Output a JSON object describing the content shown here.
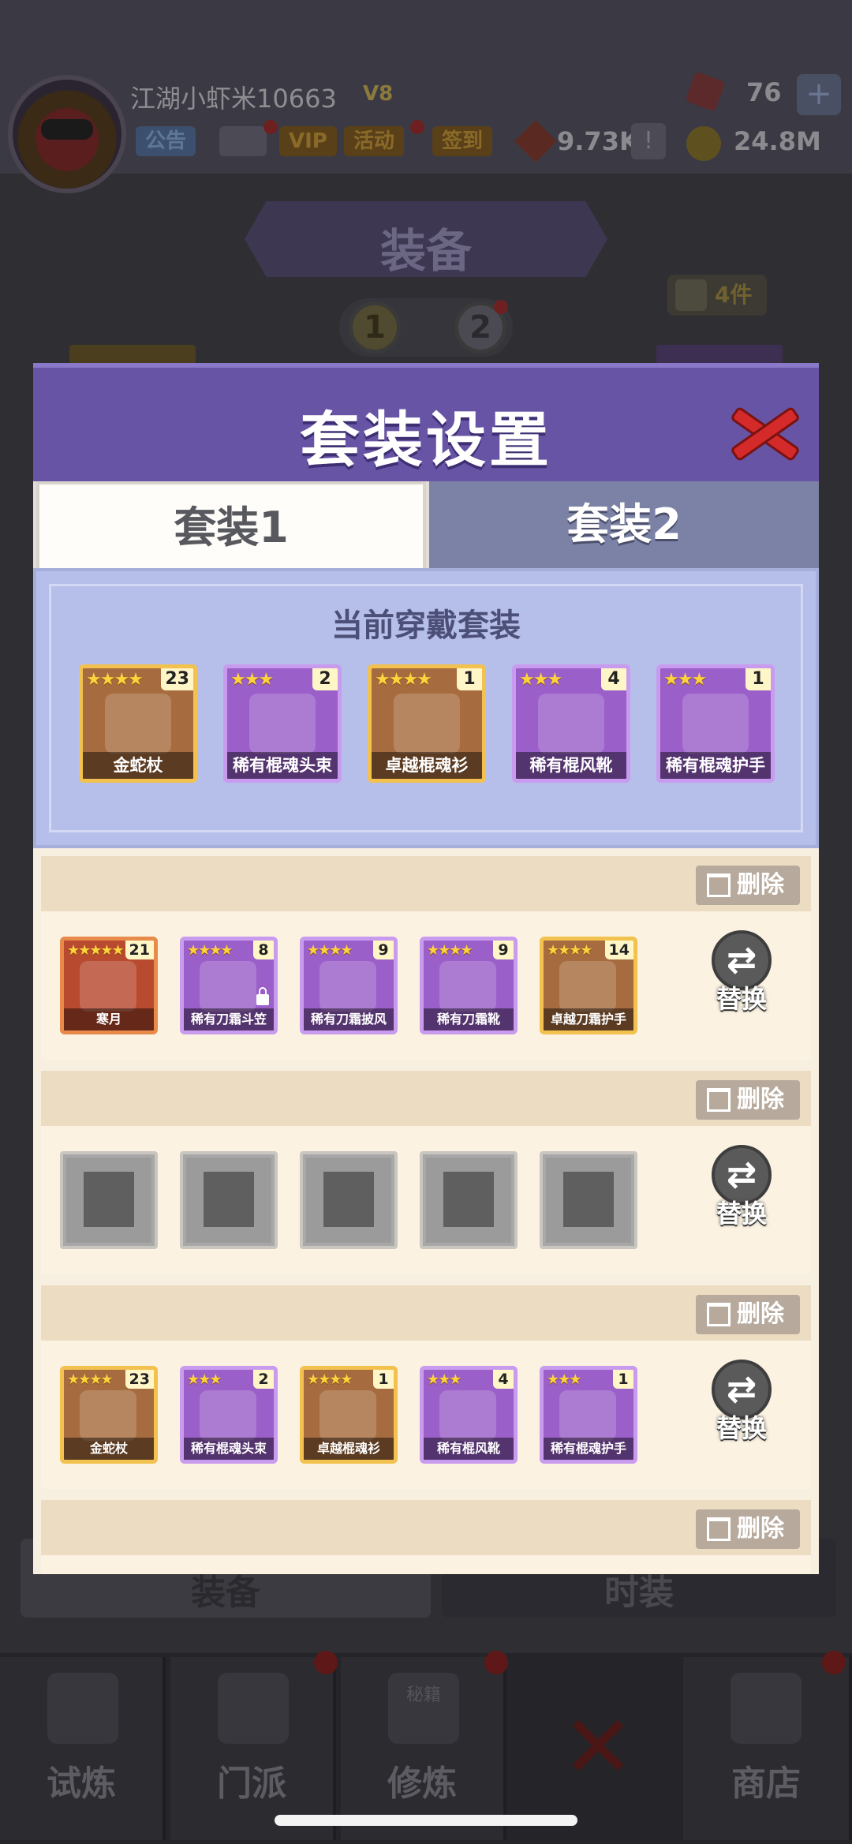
{
  "header": {
    "username": "江湖小虾米10663",
    "vip_level": "V8",
    "buttons": {
      "notice": "公告",
      "vip": "VIP",
      "activity": "活动",
      "signin": "签到"
    },
    "resources": {
      "gems": "76",
      "tickets": "9.73K",
      "gold": "24.8M"
    },
    "plus": "+",
    "info": "!"
  },
  "page": {
    "title": "装备",
    "count_badge": "4件",
    "pages": [
      "1",
      "2"
    ],
    "bottom_tabs": [
      "装备",
      "时装"
    ]
  },
  "nav": {
    "items": [
      "试炼",
      "门派",
      "修炼",
      "",
      "商店"
    ],
    "book_text": "秘籍"
  },
  "modal": {
    "title": "套装设置",
    "tabs": [
      "套装1",
      "套装2"
    ],
    "current_title": "当前穿戴套装",
    "current_items": [
      {
        "name": "金蛇杖",
        "stars": "★★★★",
        "count": "23",
        "rarity": "gold"
      },
      {
        "name": "稀有棍魂头束",
        "stars": "★★★",
        "count": "2",
        "rarity": "purple"
      },
      {
        "name": "卓越棍魂衫",
        "stars": "★★★★",
        "count": "1",
        "rarity": "gold"
      },
      {
        "name": "稀有棍风靴",
        "stars": "★★★",
        "count": "4",
        "rarity": "purple"
      },
      {
        "name": "稀有棍魂护手",
        "stars": "★★★",
        "count": "1",
        "rarity": "purple"
      }
    ],
    "delete_label": "删除",
    "replace_label": "替换",
    "saved_sets": [
      {
        "items": [
          {
            "name": "寒月",
            "stars": "★★★★★",
            "count": "21",
            "rarity": "red"
          },
          {
            "name": "稀有刀霜斗笠",
            "stars": "★★★★",
            "count": "8",
            "rarity": "purple",
            "locked": true
          },
          {
            "name": "稀有刀霜披风",
            "stars": "★★★★",
            "count": "9",
            "rarity": "purple"
          },
          {
            "name": "稀有刀霜靴",
            "stars": "★★★★",
            "count": "9",
            "rarity": "purple"
          },
          {
            "name": "卓越刀霜护手",
            "stars": "★★★★",
            "count": "14",
            "rarity": "gold"
          }
        ]
      },
      {
        "items": []
      },
      {
        "items": [
          {
            "name": "金蛇杖",
            "stars": "★★★★",
            "count": "23",
            "rarity": "gold"
          },
          {
            "name": "稀有棍魂头束",
            "stars": "★★★",
            "count": "2",
            "rarity": "purple"
          },
          {
            "name": "卓越棍魂衫",
            "stars": "★★★★",
            "count": "1",
            "rarity": "gold"
          },
          {
            "name": "稀有棍风靴",
            "stars": "★★★",
            "count": "4",
            "rarity": "purple"
          },
          {
            "name": "稀有棍魂护手",
            "stars": "★★★",
            "count": "1",
            "rarity": "purple"
          }
        ]
      },
      {
        "items": []
      }
    ],
    "empty_slot_icons": [
      "weapon-slot-icon",
      "helmet-slot-icon",
      "armor-slot-icon",
      "boots-slot-icon",
      "gloves-slot-icon"
    ]
  }
}
